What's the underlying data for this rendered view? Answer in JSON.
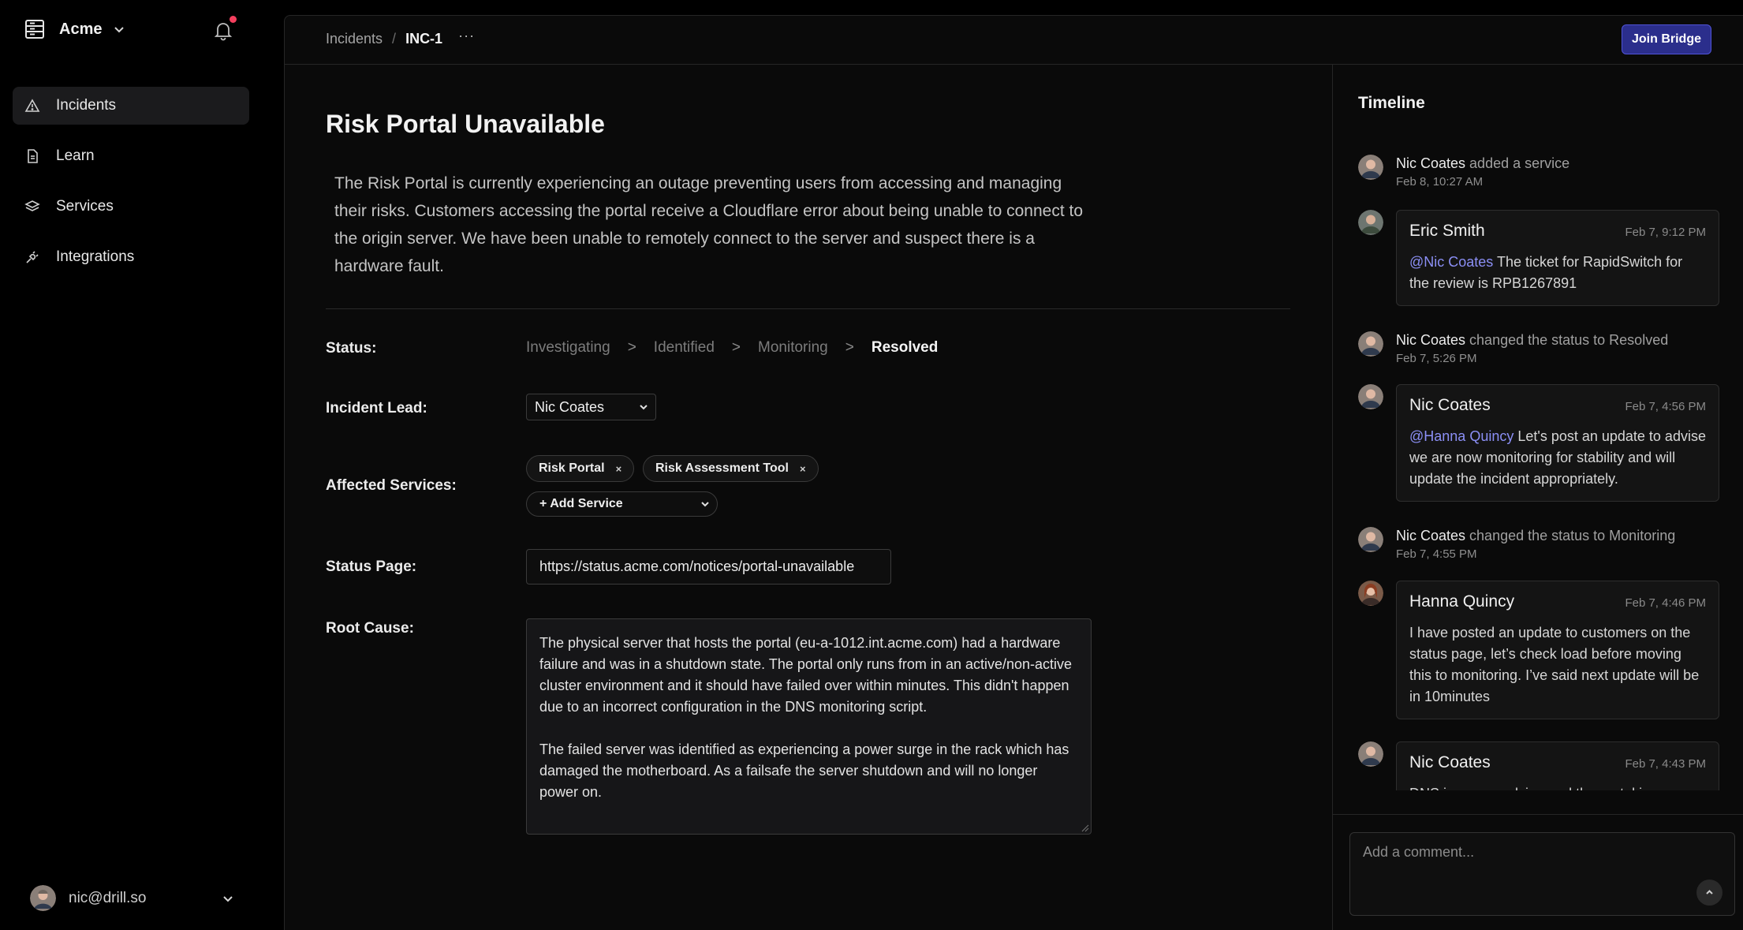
{
  "sidebar": {
    "org_name": "Acme",
    "notification_dot_color": "#f43f5e",
    "items": [
      {
        "label": "Incidents",
        "icon": "warning-triangle-icon",
        "active": true
      },
      {
        "label": "Learn",
        "icon": "document-icon",
        "active": false
      },
      {
        "label": "Services",
        "icon": "layers-icon",
        "active": false
      },
      {
        "label": "Integrations",
        "icon": "plug-icon",
        "active": false
      }
    ],
    "user_email": "nic@drill.so"
  },
  "topbar": {
    "breadcrumb_parent": "Incidents",
    "breadcrumb_separator": "/",
    "breadcrumb_current": "INC-1",
    "more_label": "···",
    "join_bridge_label": "Join Bridge",
    "accent_color": "#2b2e8c"
  },
  "incident": {
    "title": "Risk Portal Unavailable",
    "description": "The Risk Portal is currently experiencing an outage preventing users from accessing and managing their risks. Customers accessing the portal receive a Cloudflare error about being unable to connect to the origin server. We have been unable to remotely connect to the server and suspect there is a hardware fault.",
    "status_label": "Status:",
    "status_steps": [
      "Investigating",
      "Identified",
      "Monitoring",
      "Resolved"
    ],
    "status_arrow": ">",
    "status_current": "Resolved",
    "lead_label": "Incident Lead:",
    "lead_value": "Nic Coates",
    "services_label": "Affected Services:",
    "services": [
      "Risk Portal",
      "Risk Assessment Tool"
    ],
    "chip_remove": "×",
    "add_service_label": "+ Add Service",
    "status_page_label": "Status Page:",
    "status_page_url": "https://status.acme.com/notices/portal-unavailable",
    "root_cause_label": "Root Cause:",
    "root_cause_p1": "The physical server that hosts the portal (eu-a-1012.int.acme.com) had a hardware failure and was in a shutdown state. The portal only runs from in an active/non-active cluster environment and it should have failed over within minutes. This didn't happen due to an incorrect configuration in the DNS monitoring script.",
    "root_cause_p2": "The failed server was identified as experiencing a power surge in the rack which has damaged the motherboard. As a failsafe the server shutdown and will no longer power on."
  },
  "timeline": {
    "title": "Timeline",
    "events": [
      {
        "type": "event",
        "actor": "Nic Coates",
        "action": "added a service",
        "time": "Feb 8, 10:27 AM"
      },
      {
        "type": "comment",
        "author": "Eric Smith",
        "time": "Feb 7, 9:12 PM",
        "mention": "@Nic Coates",
        "text": "The ticket for RapidSwitch for the review is RPB1267891"
      },
      {
        "type": "event",
        "actor": "Nic Coates",
        "action": "changed the status to Resolved",
        "time": "Feb 7, 5:26 PM"
      },
      {
        "type": "comment",
        "author": "Nic Coates",
        "time": "Feb 7, 4:56 PM",
        "mention": "@Hanna Quincy",
        "text": "Let's post an update to advise we are now monitoring for stability and will update the incident appropriately."
      },
      {
        "type": "event",
        "actor": "Nic Coates",
        "action": "changed the status to Monitoring",
        "time": "Feb 7, 4:55 PM"
      },
      {
        "type": "comment",
        "author": "Hanna Quincy",
        "time": "Feb 7, 4:46 PM",
        "mention": "",
        "text": "I have posted an update to customers on the status page, let’s check load before moving this to monitoring. I’ve said next update will be in 10minutes"
      },
      {
        "type": "comment",
        "author": "Nic Coates",
        "time": "Feb 7, 4:43 PM",
        "mention": "",
        "text": "DNS is now resolving and the portal is"
      }
    ],
    "comment_placeholder": "Add a comment..."
  }
}
